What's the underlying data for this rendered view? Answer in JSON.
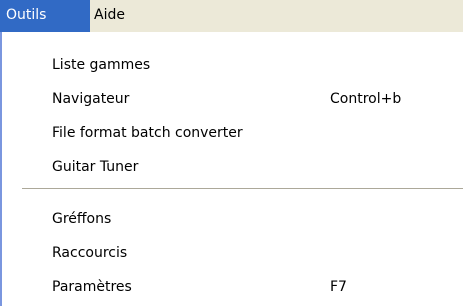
{
  "menubar": {
    "items": [
      {
        "label": "Outils",
        "active": true
      },
      {
        "label": "Aide",
        "active": false
      }
    ]
  },
  "menu": {
    "groups": [
      {
        "items": [
          {
            "label": "Liste gammes",
            "shortcut": ""
          },
          {
            "label": "Navigateur",
            "shortcut": "Control+b"
          },
          {
            "label": "File format batch converter",
            "shortcut": ""
          },
          {
            "label": "Guitar Tuner",
            "shortcut": ""
          }
        ]
      },
      {
        "items": [
          {
            "label": "Gréffons",
            "shortcut": ""
          },
          {
            "label": "Raccourcis",
            "shortcut": ""
          },
          {
            "label": "Paramètres",
            "shortcut": "F7"
          }
        ]
      }
    ]
  },
  "colors": {
    "selection": "#316ac5",
    "menu_background": "#ffffff",
    "menubar_background": "#ece9d8"
  }
}
